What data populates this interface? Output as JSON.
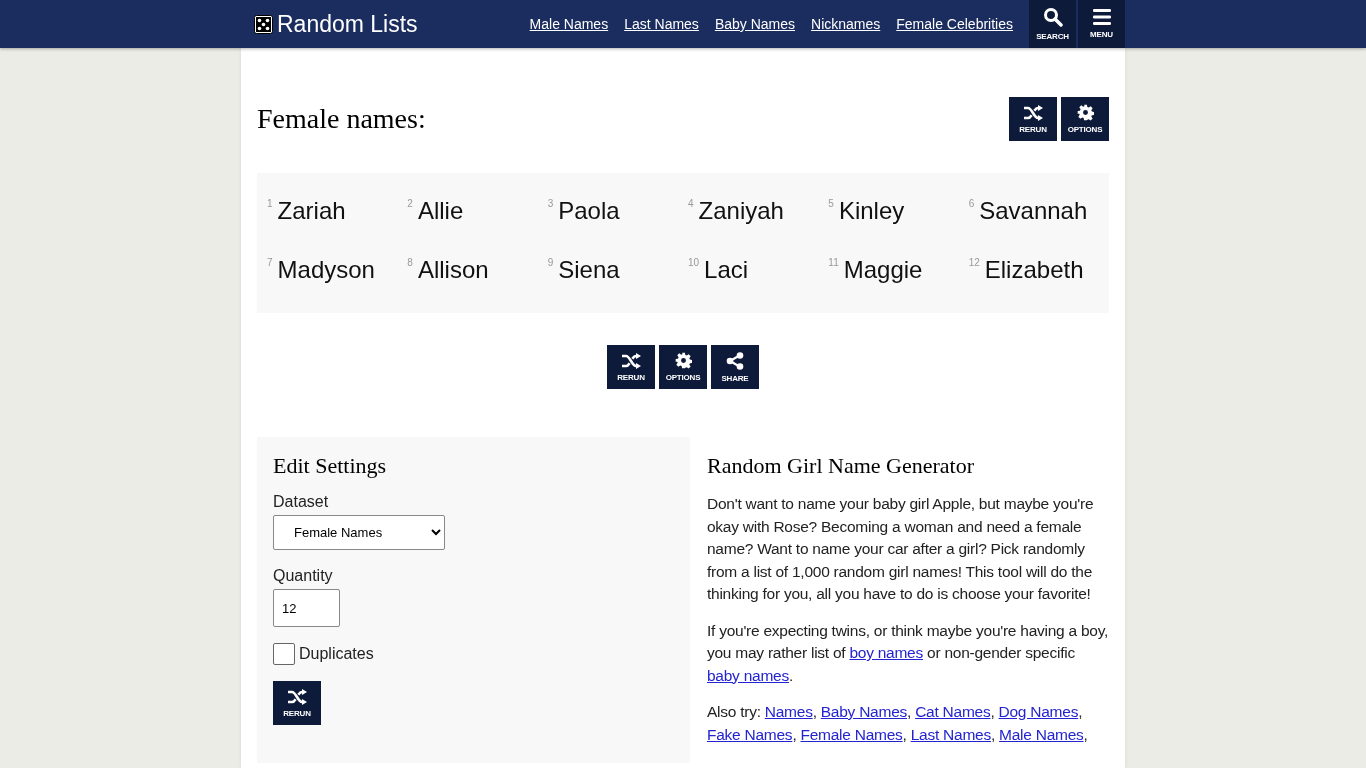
{
  "header": {
    "logo": "Random Lists",
    "nav": [
      "Male Names",
      "Last Names",
      "Baby Names",
      "Nicknames",
      "Female Celebrities"
    ],
    "buttons": [
      {
        "kind": "search",
        "label": "SEARCH"
      },
      {
        "kind": "menu",
        "label": "MENU"
      }
    ]
  },
  "title": "Female names:",
  "top_buttons": [
    {
      "kind": "rerun",
      "label": "RERUN"
    },
    {
      "kind": "options",
      "label": "OPTIONS"
    }
  ],
  "names": [
    {
      "number": "1",
      "name": "Zariah"
    },
    {
      "number": "2",
      "name": "Allie"
    },
    {
      "number": "3",
      "name": "Paola"
    },
    {
      "number": "4",
      "name": "Zaniyah"
    },
    {
      "number": "5",
      "name": "Kinley"
    },
    {
      "number": "6",
      "name": "Savannah"
    },
    {
      "number": "7",
      "name": "Madyson"
    },
    {
      "number": "8",
      "name": "Allison"
    },
    {
      "number": "9",
      "name": "Siena"
    },
    {
      "number": "10",
      "name": "Laci"
    },
    {
      "number": "11",
      "name": "Maggie"
    },
    {
      "number": "12",
      "name": "Elizabeth"
    }
  ],
  "action_buttons": [
    {
      "kind": "rerun",
      "label": "RERUN"
    },
    {
      "kind": "options",
      "label": "OPTIONS"
    },
    {
      "kind": "share",
      "label": "SHARE"
    }
  ],
  "settings": {
    "title": "Edit Settings",
    "dataset_label": "Dataset",
    "dataset_value": "Female Names",
    "quantity_label": "Quantity",
    "quantity_value": "12",
    "duplicates_label": "Duplicates",
    "duplicates_checked": false,
    "button": {
      "kind": "rerun",
      "label": "RERUN"
    }
  },
  "about": {
    "title": "Random Girl Name Generator",
    "paragraphs": [
      [
        {
          "kind": "text",
          "text": "Don't want to name your baby girl Apple, but maybe you're okay with Rose? Becoming a woman and need a female name? Want to name your car after a girl? Pick randomly from a list of 1,000 random girl names! This tool will do the thinking for you, all you have to do is choose your favorite!"
        }
      ],
      [
        {
          "kind": "text",
          "text": "If you're expecting twins, or think maybe you're having a boy, you may rather list of "
        },
        {
          "kind": "link",
          "text": "boy names"
        },
        {
          "kind": "text",
          "text": " or non-gender specific "
        },
        {
          "kind": "link",
          "text": "baby names"
        },
        {
          "kind": "text",
          "text": "."
        }
      ],
      [
        {
          "kind": "text",
          "text": "Also try: "
        },
        {
          "kind": "link",
          "text": "Names"
        },
        {
          "kind": "text",
          "text": ", "
        },
        {
          "kind": "link",
          "text": "Baby Names"
        },
        {
          "kind": "text",
          "text": ", "
        },
        {
          "kind": "link",
          "text": "Cat Names"
        },
        {
          "kind": "text",
          "text": ", "
        },
        {
          "kind": "link",
          "text": "Dog Names"
        },
        {
          "kind": "text",
          "text": ", "
        },
        {
          "kind": "link",
          "text": "Fake Names"
        },
        {
          "kind": "text",
          "text": ", "
        },
        {
          "kind": "link",
          "text": "Female Names"
        },
        {
          "kind": "text",
          "text": ", "
        },
        {
          "kind": "link",
          "text": "Last Names"
        },
        {
          "kind": "text",
          "text": ", "
        },
        {
          "kind": "link",
          "text": "Male Names"
        },
        {
          "kind": "text",
          "text": ","
        }
      ]
    ]
  }
}
